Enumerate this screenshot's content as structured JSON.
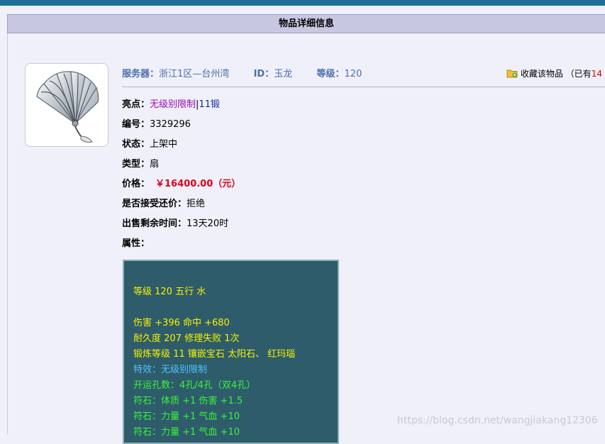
{
  "page_title": "物品详细信息",
  "header": {
    "server_label": "服务器：",
    "server_value": "浙江1区—台州湾",
    "id_label": "ID：",
    "id_value": "玉龙",
    "level_label": "等级：",
    "level_value": "120"
  },
  "favorite": {
    "label": "收藏该物品",
    "count_prefix": "（已有",
    "count_value": "14"
  },
  "details": {
    "highlight_label": "亮点：",
    "highlight_value1": "无级别限制",
    "highlight_sep": "|",
    "highlight_value2": "11锻",
    "number_label": "编号：",
    "number_value": "3329296",
    "status_label": "状态：",
    "status_value": "上架中",
    "type_label": "类型：",
    "type_value": "扇",
    "price_label": "价格：",
    "price_value": "￥16400.00（元）",
    "bargain_label": "是否接受还价：",
    "bargain_value": "拒绝",
    "remaining_label": "出售剩余时间：",
    "remaining_value": "13天20时",
    "attr_label": "属性："
  },
  "attributes": [
    "等级 120 五行 水",
    "伤害 +396 命中 +680",
    "耐久度 207 修理失败 1次",
    "锻炼等级 11 镶嵌宝石 太阳石、 红玛瑙",
    "特效：无级别限制",
    "开运孔数：4孔/4孔（双4孔）",
    "符石：体质 +1 伤害 +1.5",
    "符石：力量 +1 气血 +10",
    "符石：力量 +1 气血 +10"
  ],
  "watermark": "https://blog.csdn.net/wangjiakang12306",
  "colors": {
    "topbar": "#1f6e9a",
    "title_bg": "#c7c7e2",
    "attr_bg": "#2e5c6b",
    "attr_yellow": "#f5f200",
    "attr_cyan": "#4fc3ff",
    "attr_green": "#39f43a",
    "price_red": "#e0001a"
  }
}
